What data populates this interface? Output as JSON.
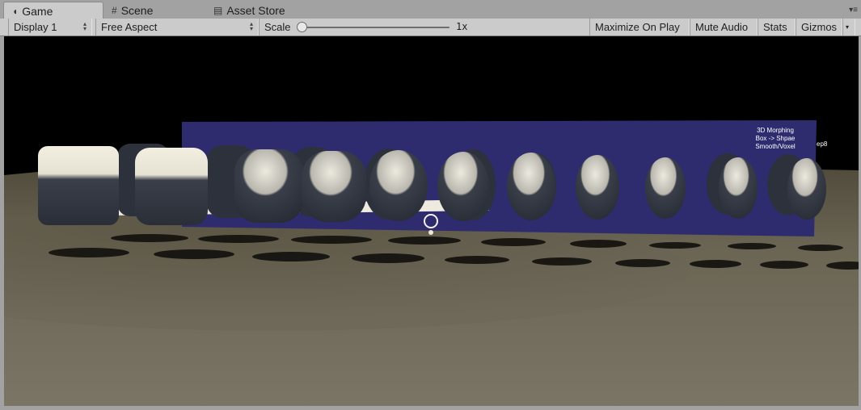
{
  "tabs": [
    {
      "label": "Game",
      "icon": "pacman-icon"
    },
    {
      "label": "Scene",
      "icon": "grid-icon"
    },
    {
      "label": "Asset Store",
      "icon": "bag-icon"
    }
  ],
  "toolbar": {
    "display": "Display 1",
    "aspect": "Free Aspect",
    "scale_label": "Scale",
    "scale_value": "1x",
    "maximize": "Maximize On Play",
    "mute": "Mute Audio",
    "stats": "Stats",
    "gizmos": "Gizmos"
  },
  "panel": {
    "line1": "3D Morphing",
    "line2": "Box -> Shpae",
    "line3": "Smooth/Voxel",
    "extra": "ep8"
  },
  "colors": {
    "background": "#000000",
    "panel": "#2e2c6e",
    "ground": "#6d6758",
    "object": "#2f333d",
    "highlight": "#f3efe0"
  }
}
